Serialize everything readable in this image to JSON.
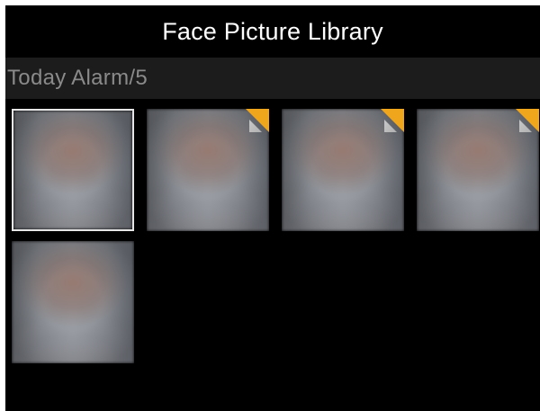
{
  "app": {
    "title": "Face Picture Library"
  },
  "section": {
    "label": "Today Alarm/5"
  },
  "thumbnails": [
    {
      "selected": true,
      "flagged": false
    },
    {
      "selected": false,
      "flagged": true
    },
    {
      "selected": false,
      "flagged": true
    },
    {
      "selected": false,
      "flagged": true
    },
    {
      "selected": false,
      "flagged": false
    }
  ],
  "colors": {
    "background": "#000000",
    "header_bar": "#1c1c1c",
    "header_text": "#8a8a8a",
    "flag": "#f0a61c",
    "selected_border": "#e6e6e6"
  }
}
